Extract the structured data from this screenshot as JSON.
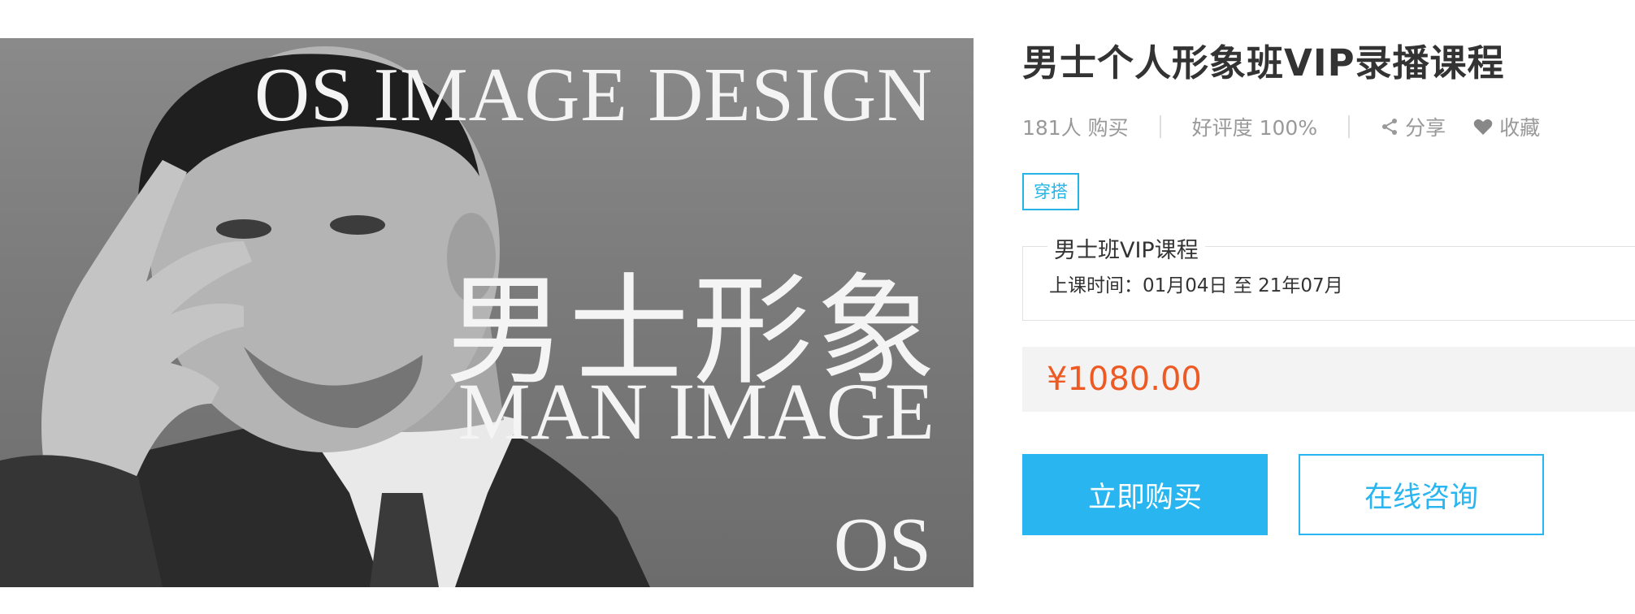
{
  "banner": {
    "top_text": "OS IMAGE DESIGN",
    "cn_text": "男士形象",
    "en_text": "MAN IMAGE",
    "brand_text": "OS"
  },
  "course": {
    "title": "男士个人形象班VIP录播课程",
    "buyers": "181人 购买",
    "rating": "好评度 100%",
    "share_label": "分享",
    "favorite_label": "收藏",
    "tag": "穿搭",
    "session_name": "男士班VIP课程",
    "session_time": "上课时间：01月04日 至 21年07月",
    "price": "¥1080.00"
  },
  "actions": {
    "buy_label": "立即购买",
    "consult_label": "在线咨询"
  },
  "colors": {
    "accent": "#29b6f0",
    "price": "#ee5a24",
    "muted": "#999999"
  },
  "icons": {
    "share": "share-icon",
    "favorite": "heart-icon"
  }
}
